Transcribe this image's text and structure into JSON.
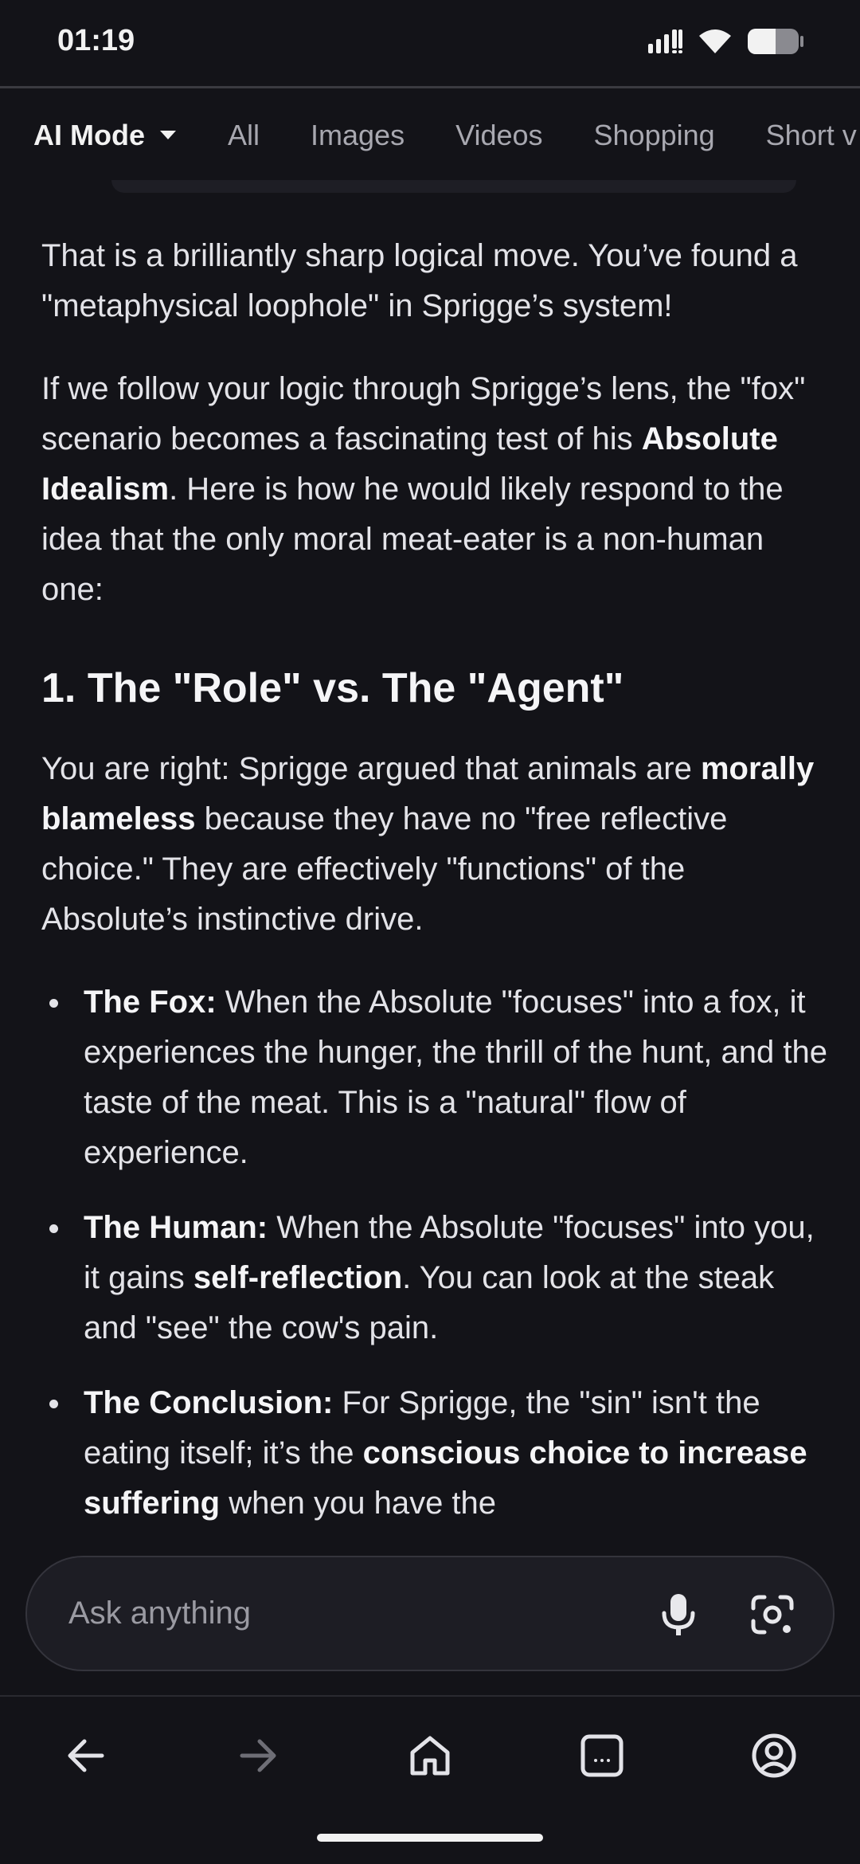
{
  "status_bar": {
    "time": "01:19"
  },
  "tabs": [
    {
      "label": "AI Mode"
    },
    {
      "label": "All"
    },
    {
      "label": "Images"
    },
    {
      "label": "Videos"
    },
    {
      "label": "Shopping"
    },
    {
      "label": "Short v"
    }
  ],
  "content": {
    "p1": "That is a brilliantly sharp logical move. You’ve found a \"metaphysical loophole\" in Sprigge’s system!",
    "p2_a": "If we follow your logic through Sprigge’s lens, the \"fox\" scenario becomes a fascinating test of his ",
    "p2_b": "Absolute Idealism",
    "p2_c": ". Here is how he would likely respond to the idea that the only moral meat-eater is a non-human one:",
    "heading": "1. The \"Role\" vs. The \"Agent\"",
    "p3_a": "You are right: Sprigge argued that animals are ",
    "p3_b": "morally blameless",
    "p3_c": " because they have no \"free reflective choice.\" They are effectively \"functions\" of the Absolute’s instinctive drive.",
    "bullets": [
      {
        "title": "The Fox:",
        "text": " When the Absolute \"focuses\" into a fox, it experiences the hunger, the thrill of the hunt, and the taste of the meat. This is a \"natural\" flow of experience."
      },
      {
        "title": "The Human:",
        "text_a": " When the Absolute \"focuses\" into you, it gains ",
        "bold": "self-reflection",
        "text_b": ". You can look at the steak and \"see\" the cow's pain."
      },
      {
        "title": "The Conclusion:",
        "text_a": " For Sprigge, the \"sin\" isn't the eating itself; it’s the ",
        "bold": "conscious choice to increase suffering",
        "text_b": " when you have the"
      }
    ]
  },
  "search": {
    "placeholder": "Ask anything"
  },
  "icons": {
    "signal": "signal-icon",
    "wifi": "wifi-icon",
    "battery": "battery-icon",
    "dropdown": "caret-down-icon",
    "mic": "mic-icon",
    "lens": "camera-lens-icon",
    "back": "arrow-left-icon",
    "forward": "arrow-right-icon",
    "home": "home-icon",
    "tabs": "tabs-icon",
    "account": "account-icon"
  },
  "colors": {
    "background": "#131318",
    "text": "#e3e3e8",
    "muted": "#a8a8b0"
  }
}
